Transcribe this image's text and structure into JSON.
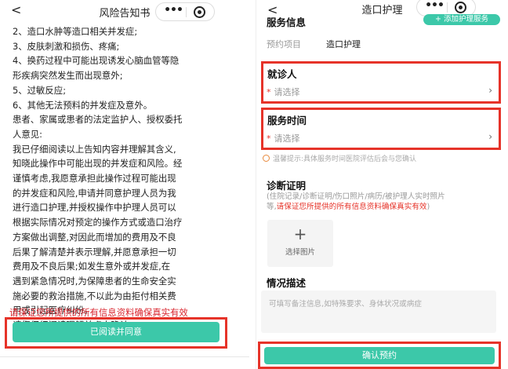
{
  "left": {
    "nav": {
      "back_glyph": "<",
      "title": "风险告知书",
      "menu_icon": "more-dots-icon",
      "close_icon": "target-circle-icon"
    },
    "notice_lines": [
      "2、造口水肿等造口相关并发症;",
      "3、皮肤刺激和损伤、疼痛;",
      "4、换药过程中可能出现诱发心脑血管等隐",
      "形疾病突然发生而出现意外;",
      "5、过敏反应;",
      "6、其他无法预料的并发症及意外。",
      "患者、家属或患者的法定监护人、授权委托",
      "人意见:",
      "我已仔细阅读以上告知内容并理解其含义,",
      "知晓此操作中可能出现的并发症和风险。经",
      "谨慎考虑,我愿意承担此操作过程可能出现",
      "的并发症和风险,申请并同意护理人员为我",
      "进行造口护理,并授权操作中护理人员可以",
      "根据实际情况对预定的操作方式或造口治疗",
      "方案做出调整,对因此而增加的费用及不良",
      "后果了解清楚并表示理解,并愿意承担一切",
      "费用及不良后果;如发生意外或并发症,在",
      "遇到紧急情况时,为保障患者的生命安全实",
      "施必要的救治措施,不以此为由拒付相关费",
      "用或引起医疗纠纷。",
      "请您仔细阅读理解并点击确认。"
    ],
    "warning": "请保证您所提供的所有信息资料确保真实有效",
    "confirm_button": "已阅读并同意"
  },
  "right": {
    "nav": {
      "back_glyph": "<",
      "title": "造口护理",
      "menu_icon": "more-dots-icon",
      "close_icon": "target-circle-icon"
    },
    "service_info_title": "服务信息",
    "add_service_button": "+ 添加护理服务",
    "project_label": "预约项目",
    "project_value": "造口护理",
    "patient": {
      "title": "就诊人",
      "required_mark": "*",
      "placeholder": "请选择"
    },
    "service_time": {
      "title": "服务时间",
      "required_mark": "*",
      "placeholder": "请选择"
    },
    "tip": "温馨提示:具体服务时间医院评估后会与您确认",
    "diagnosis": {
      "title": "诊断证明",
      "desc_line1": "(住院记录/诊断证明/伤口照片/病历/被护理人实时照片",
      "desc_line2_prefix": "等,",
      "desc_line2_red": "请保证您所提供的所有信息资料确保真实有效",
      "desc_line2_suffix": ")"
    },
    "upload": {
      "plus": "+",
      "label": "选择图片"
    },
    "situation": {
      "title": "情况描述",
      "placeholder": "可填写备注信息,如特殊要求、身体状况或病症"
    },
    "submit_button": "确认预约"
  }
}
